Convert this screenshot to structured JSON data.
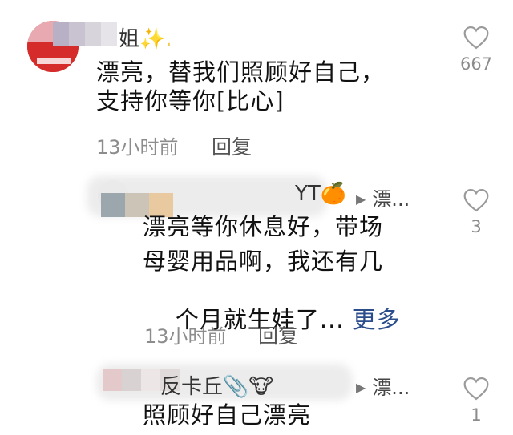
{
  "comments": [
    {
      "user_suffix": "姐",
      "user_suffix_decoration": "✨.",
      "text_lines": [
        "漂亮，替我们照顾好自己，",
        "支持你等你[比心]"
      ],
      "time": "13小时前",
      "reply_label": "回复",
      "like_count": "667"
    },
    {
      "user_suffix": "YT🍊",
      "reply_to": "漂...",
      "text_lines": [
        "漂亮等你休息好，带场",
        "母婴用品啊，我还有几",
        "个月就生娃了..."
      ],
      "more_label": "更多",
      "time": "13小时前",
      "reply_label": "回复",
      "like_count": "3"
    },
    {
      "user_suffix": "反卡丘📎🐮",
      "reply_to": "漂...",
      "text_lines": [
        "照顾好自己漂亮"
      ],
      "like_count": "1"
    }
  ],
  "icons": {
    "like": "heart-outline-icon",
    "reply_arrow": "play-triangle-icon"
  },
  "colors": {
    "text": "#111111",
    "meta": "#8c8c8c",
    "more_link": "#2c4d8c",
    "icon_stroke": "#9a9a9a"
  }
}
